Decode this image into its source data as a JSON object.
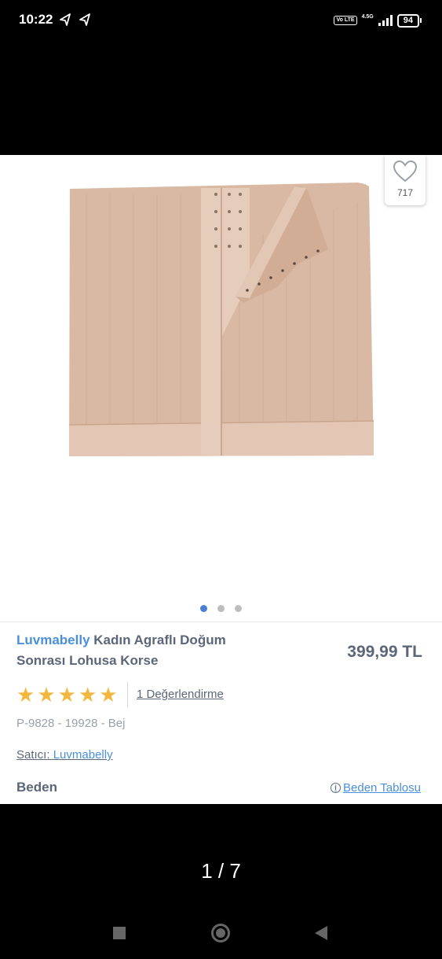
{
  "status_bar": {
    "time": "10:22",
    "volte": "Vo LTE",
    "network": "4.5G",
    "battery": "94"
  },
  "product": {
    "favorite_count": "717",
    "brand": "Luvmabelly",
    "name": "Kadın Agraflı Doğum Sonrası Lohusa Korse",
    "price": "399,99 TL",
    "rating": 5,
    "reviews_link": "1 Değerlendirme",
    "sku": "P-9828 - 19928 - Bej",
    "seller_label": "Satıcı:",
    "seller_name": "Luvmabelly",
    "size_label": "Beden",
    "size_table_link": "Beden Tablosu",
    "image_count": 3,
    "active_image": 1
  },
  "viewer": {
    "counter": "1 / 7"
  },
  "colors": {
    "accent": "#4a8fdb",
    "star": "#f4b73d",
    "text": "#5b6679",
    "garment": "#d9b9a3"
  }
}
